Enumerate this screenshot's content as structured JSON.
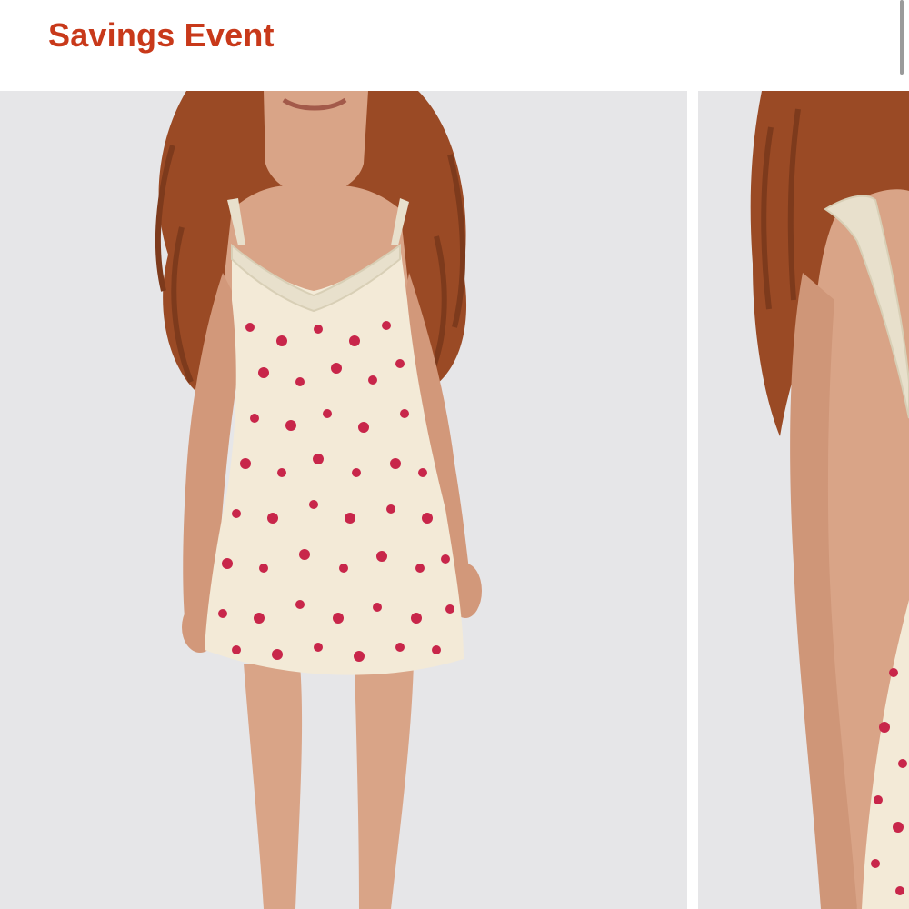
{
  "header": {
    "title": "Savings Event",
    "title_color": "#c8391a"
  },
  "carousel": {
    "images": [
      {
        "name": "product-image-front",
        "icon": "model-floral-dress-front"
      },
      {
        "name": "product-image-back",
        "icon": "model-floral-dress-back"
      }
    ]
  },
  "colors": {
    "background": "#e6e6e8",
    "dress": "#f3ead7",
    "flower": "#c8264a",
    "lace": "#e8e0cc",
    "hair": "#9a4a25",
    "skin": "#d9a487"
  }
}
